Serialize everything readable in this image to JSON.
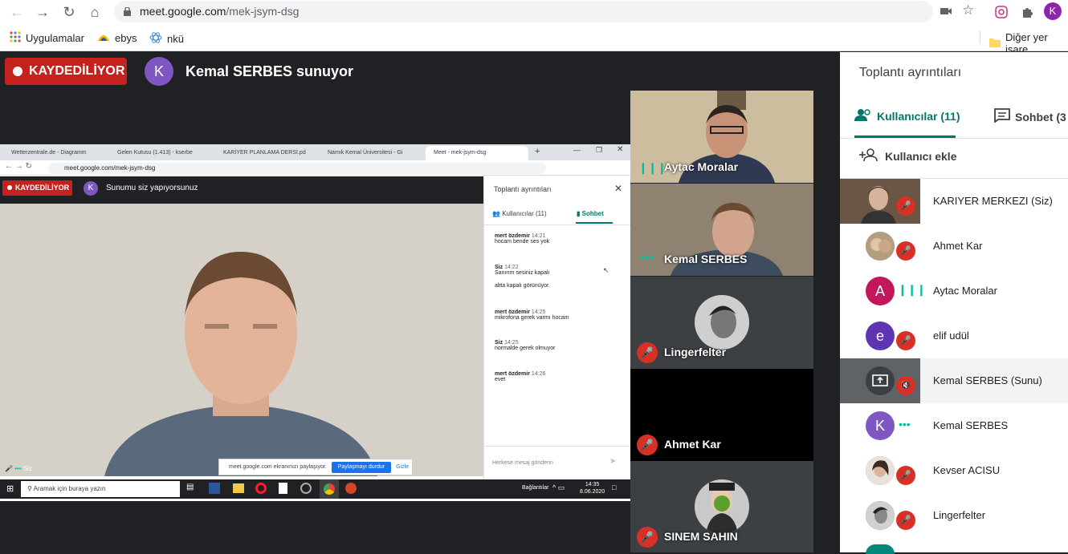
{
  "browser": {
    "url_host": "meet.google.com",
    "url_path": "/mek-jsym-dsg",
    "profile_initial": "K",
    "bookmarks": [
      {
        "label": "Uygulamalar",
        "icon": "apps-grid-icon"
      },
      {
        "label": "ebys",
        "icon": "ebys-logo-icon"
      },
      {
        "label": "nkü",
        "icon": "atom-icon"
      }
    ],
    "other_bookmarks": "Diğer yer işare"
  },
  "meet": {
    "recording_label": "KAYDEDİLİYOR",
    "presenter_initial": "K",
    "presenter_text": "Kemal SERBES sunuyor"
  },
  "shared_screen": {
    "tabs": [
      "Wetterzentrale.de - Diagramm",
      "Gelen Kutusu (1.413) - kserbe",
      "KARİYER PLANLAMA DERSİ.pd",
      "Namık Kemal Üniversitesi - Gi",
      "Meet - mek-jsym-dsg"
    ],
    "address": "meet.google.com/mek-jsym-dsg",
    "recording_label": "KAYDEDİLİYOR",
    "avatar_initial": "K",
    "presenting_text": "Sunumu siz yapıyorsunuz",
    "panel_title": "Toplantı ayrıntıları",
    "panel_tab_users": "Kullanıcılar (11)",
    "panel_tab_chat": "Sohbet",
    "messages": [
      {
        "name": "mert özdemir",
        "time": "14:21",
        "lines": [
          "hocam bende ses yok"
        ]
      },
      {
        "name": "Siz",
        "time": "14:22",
        "lines": [
          "Sanırım sesiniz kapalı",
          "altta kapalı görünüyor."
        ]
      },
      {
        "name": "mert özdemir",
        "time": "14:25",
        "lines": [
          "mikrofona gerek varmı hocam"
        ]
      },
      {
        "name": "Siz",
        "time": "14:25",
        "lines": [
          "normalde gerek olmuyor"
        ]
      },
      {
        "name": "mert özdemir",
        "time": "14:26",
        "lines": [
          "evet"
        ]
      }
    ],
    "message_placeholder": "Herkese mesaj gönderin",
    "self_label": "Siz",
    "share_text": "meet.google.com ekranınızı paylaşıyor.",
    "share_stop": "Paylaşmayı durdur",
    "share_hide": "Gizle",
    "taskbar_search": "Aramak için buraya yazın",
    "taskbar_status": "Bağlantılar",
    "taskbar_time": "14:35",
    "taskbar_date": "8.06.2020"
  },
  "tiles": [
    {
      "name": "Aytac Moralar",
      "indicator": "speaking"
    },
    {
      "name": "Kemal SERBES",
      "indicator": "dots"
    },
    {
      "name": "Lingerfelter",
      "indicator": "muted"
    },
    {
      "name": "Ahmet Kar",
      "indicator": "muted"
    },
    {
      "name": "SINEM SAHIN",
      "indicator": "muted"
    }
  ],
  "side_panel": {
    "title": "Toplantı ayrıntıları",
    "tab_users": "Kullanıcılar (11)",
    "tab_chat": "Sohbet (3",
    "add_user": "Kullanıcı ekle",
    "participants": [
      {
        "name": "KARIYER MERKEZI (Siz)",
        "initial": "",
        "color": "#5d4a3a",
        "status": "muted"
      },
      {
        "name": "Ahmet Kar",
        "initial": "",
        "color": "#a08a6e",
        "status": "muted"
      },
      {
        "name": "Aytac Moralar",
        "initial": "A",
        "color": "#c2185b",
        "status": "speaking"
      },
      {
        "name": "elif udül",
        "initial": "e",
        "color": "#5e35b1",
        "status": "muted"
      },
      {
        "name": "Kemal SERBES (Sunu)",
        "initial": "",
        "color": "#5f6368",
        "status": "muted"
      },
      {
        "name": "Kemal SERBES",
        "initial": "K",
        "color": "#7e57c2",
        "status": "dots"
      },
      {
        "name": "Kevser ACISU",
        "initial": "",
        "color": "#8d7b6c",
        "status": "muted"
      },
      {
        "name": "Lingerfelter",
        "initial": "",
        "color": "#444",
        "status": "muted"
      }
    ]
  }
}
